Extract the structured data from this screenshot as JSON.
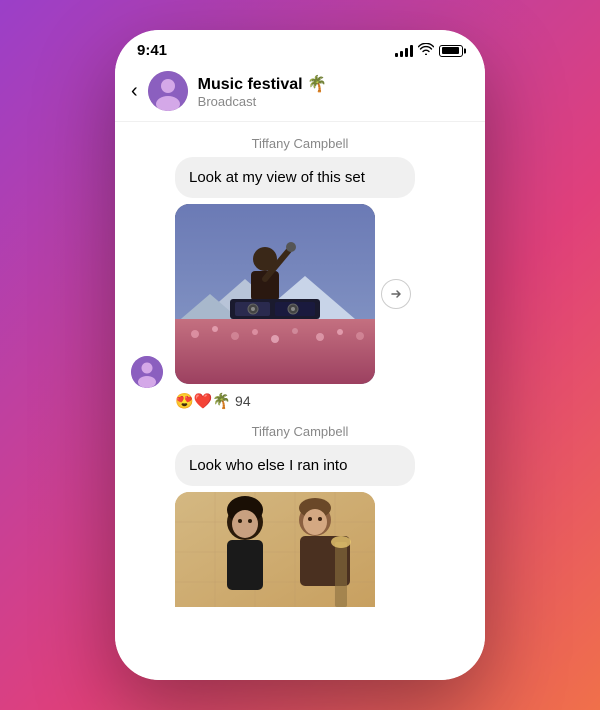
{
  "phone": {
    "status": {
      "time": "9:41",
      "signal_label": "signal",
      "wifi_label": "wifi",
      "battery_label": "battery"
    },
    "header": {
      "back_label": "‹",
      "title": "Music festival 🌴",
      "subtitle": "Broadcast",
      "avatar_emoji": "🧑"
    },
    "messages": [
      {
        "sender": "Tiffany Campbell",
        "text": "Look at my view of this set",
        "type": "text"
      },
      {
        "type": "image",
        "description": "DJ at music festival"
      },
      {
        "reactions": "😍❤️🌴",
        "count": "94"
      },
      {
        "sender": "Tiffany Campbell",
        "text": "Look who else I ran into",
        "type": "text"
      },
      {
        "type": "image",
        "description": "People at festival"
      }
    ],
    "forward_button_label": "➤"
  }
}
